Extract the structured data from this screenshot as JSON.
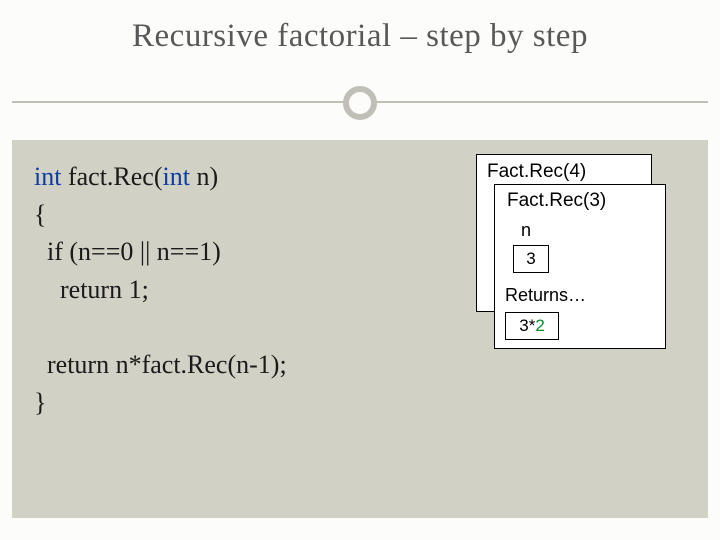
{
  "title": "Recursive factorial – step by step",
  "code": {
    "kw_int_1": "int",
    "sig_after": " fact.Rec(",
    "kw_int_2": "int",
    "sig_end": " n)",
    "brace_open": "{",
    "if_line": "  if (n==0 || n==1)",
    "ret1": "    return 1;",
    "ret2": "  return n*fact.Rec(n-1);",
    "brace_close": "}"
  },
  "stack": {
    "back_header": "Fact.Rec(4)",
    "front_header": "Fact.Rec(3)",
    "var_label": "n",
    "var_value": "3",
    "returns_label": "Returns…",
    "expr_lhs": "3",
    "expr_star": "*",
    "expr_rhs": "2"
  }
}
